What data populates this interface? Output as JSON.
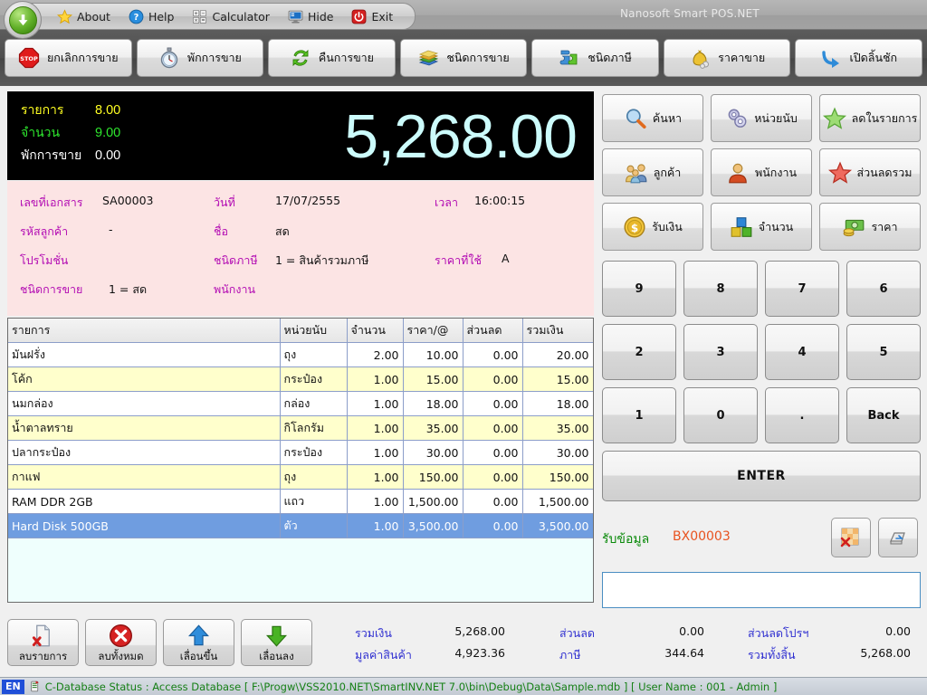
{
  "window": {
    "title": "Nanosoft Smart POS.NET"
  },
  "menu": {
    "items": [
      {
        "label": "About",
        "icon": "star-icon"
      },
      {
        "label": "Help",
        "icon": "question-icon"
      },
      {
        "label": "Calculator",
        "icon": "calculator-icon"
      },
      {
        "label": "Hide",
        "icon": "monitor-icon"
      },
      {
        "label": "Exit",
        "icon": "power-icon"
      }
    ]
  },
  "toolbar": {
    "buttons": [
      {
        "label": "ยกเลิกการขาย",
        "icon": "stop-sign-icon"
      },
      {
        "label": "พักการขาย",
        "icon": "stopwatch-icon"
      },
      {
        "label": "คืนการขาย",
        "icon": "recycle-icon"
      },
      {
        "label": "ชนิดการขาย",
        "icon": "books-icon"
      },
      {
        "label": "ชนิดภาษี",
        "icon": "puzzle-icon"
      },
      {
        "label": "ราคาขาย",
        "icon": "money-bag-icon"
      },
      {
        "label": "เปิดลิ้นชัก",
        "icon": "arrow-curve-icon"
      }
    ]
  },
  "display": {
    "rows": [
      {
        "label": "รายการ",
        "value": "8.00",
        "color": "#ffff22"
      },
      {
        "label": "จำนวน",
        "value": "9.00",
        "color": "#2ee62e"
      },
      {
        "label": "พักการขาย",
        "value": "0.00",
        "color": "#ffffff"
      }
    ],
    "total": "5,268.00"
  },
  "doc": {
    "doc_no_label": "เลขที่เอกสาร",
    "doc_no": "SA00003",
    "date_label": "วันที่",
    "date": "17/07/2555",
    "time_label": "เวลา",
    "time": "16:00:15",
    "cust_code_label": "รหัสลูกค้า",
    "cust_code": "-",
    "cust_name_label": "ชื่อ",
    "cust_name": "สด",
    "promo_label": "โปรโมชั่น",
    "promo": "",
    "tax_type_label": "ชนิดภาษี",
    "tax_type": "1 = สินค้ารวมภาษี",
    "price_used_label": "ราคาที่ใช้",
    "price_used": "A",
    "sale_type_label": "ชนิดการขาย",
    "sale_type": "1 = สด",
    "employee_label": "พนักงาน",
    "employee": ""
  },
  "grid": {
    "columns": [
      "รายการ",
      "หน่วยนับ",
      "จำนวน",
      "ราคา/@",
      "ส่วนลด",
      "รวมเงิน"
    ],
    "rows": [
      {
        "name": "มันฝรั่ง",
        "unit": "ถุง",
        "qty": "2.00",
        "price": "10.00",
        "discount": "0.00",
        "amount": "20.00",
        "selected": false
      },
      {
        "name": "โค้ก",
        "unit": "กระป๋อง",
        "qty": "1.00",
        "price": "15.00",
        "discount": "0.00",
        "amount": "15.00",
        "selected": false
      },
      {
        "name": "นมกล่อง",
        "unit": "กล่อง",
        "qty": "1.00",
        "price": "18.00",
        "discount": "0.00",
        "amount": "18.00",
        "selected": false
      },
      {
        "name": "น้ำตาลทราย",
        "unit": "กิโลกรัม",
        "qty": "1.00",
        "price": "35.00",
        "discount": "0.00",
        "amount": "35.00",
        "selected": false
      },
      {
        "name": "ปลากระป๋อง",
        "unit": "กระป๋อง",
        "qty": "1.00",
        "price": "30.00",
        "discount": "0.00",
        "amount": "30.00",
        "selected": false
      },
      {
        "name": "กาแฟ",
        "unit": "ถุง",
        "qty": "1.00",
        "price": "150.00",
        "discount": "0.00",
        "amount": "150.00",
        "selected": false
      },
      {
        "name": "RAM DDR 2GB",
        "unit": "แถว",
        "qty": "1.00",
        "price": "1,500.00",
        "discount": "0.00",
        "amount": "1,500.00",
        "selected": false
      },
      {
        "name": "Hard Disk 500GB",
        "unit": "ตัว",
        "qty": "1.00",
        "price": "3,500.00",
        "discount": "0.00",
        "amount": "3,500.00",
        "selected": true
      }
    ]
  },
  "bottom_buttons": [
    {
      "label": "ลบรายการ",
      "icon": "delete-document-icon"
    },
    {
      "label": "ลบทั้งหมด",
      "icon": "delete-all-icon"
    },
    {
      "label": "เลื่อนขึ้น",
      "icon": "arrow-up-icon"
    },
    {
      "label": "เลื่อนลง",
      "icon": "arrow-down-icon"
    }
  ],
  "totals": {
    "subtotal_label": "รวมเงิน",
    "subtotal": "5,268.00",
    "discount_label": "ส่วนลด",
    "discount": "0.00",
    "promo_discount_label": "ส่วนลดโปรฯ",
    "promo_discount": "0.00",
    "goods_value_label": "มูลค่าสินค้า",
    "goods_value": "4,923.36",
    "tax_label": "ภาษี",
    "tax": "344.64",
    "grand_total_label": "รวมทั้งสิ้น",
    "grand_total": "5,268.00"
  },
  "function_buttons": [
    {
      "label": "ค้นหา",
      "icon": "magnifier-icon"
    },
    {
      "label": "หน่วยนับ",
      "icon": "gears-icon"
    },
    {
      "label": "ลดในรายการ",
      "icon": "green-star-icon"
    },
    {
      "label": "ลูกค้า",
      "icon": "customers-icon"
    },
    {
      "label": "พนักงาน",
      "icon": "employee-icon"
    },
    {
      "label": "ส่วนลดรวม",
      "icon": "red-star-icon"
    },
    {
      "label": "รับเงิน",
      "icon": "coin-dollar-icon"
    },
    {
      "label": "จำนวน",
      "icon": "blocks-icon"
    },
    {
      "label": "ราคา",
      "icon": "cash-icon"
    }
  ],
  "keypad": {
    "rows": [
      [
        "9",
        "8",
        "7",
        "6"
      ],
      [
        "2",
        "3",
        "4",
        "5"
      ],
      [
        "1",
        "0",
        ".",
        "Back"
      ]
    ],
    "enter_label": "ENTER"
  },
  "scan": {
    "label": "รับข้อมูล",
    "value": "BX00003",
    "input_value": "",
    "input_placeholder": "",
    "clear_grid_icon": "clear-grid-icon",
    "keyboard_icon": "keyboard-key-icon"
  },
  "statusbar": {
    "lang": "EN",
    "icon": "database-icon",
    "text": "C-Database Status : Access Database [ F:\\Progw\\VSS2010.NET\\SmartINV.NET 7.0\\bin\\Debug\\Data\\Sample.mdb ]  [ User Name : 001 - Admin ]"
  },
  "colors": {
    "display_bg": "#000000",
    "display_total": "#ccfcfc",
    "doc_panel_bg": "#fce4e4",
    "doc_label": "#b30cb3",
    "row_alt": "#ffffcc",
    "row_selected": "#6f9de0",
    "totals_label": "#2f2fd0",
    "scan_label": "#0a8a0a",
    "scan_value": "#e8531f",
    "status_text": "#168016"
  }
}
